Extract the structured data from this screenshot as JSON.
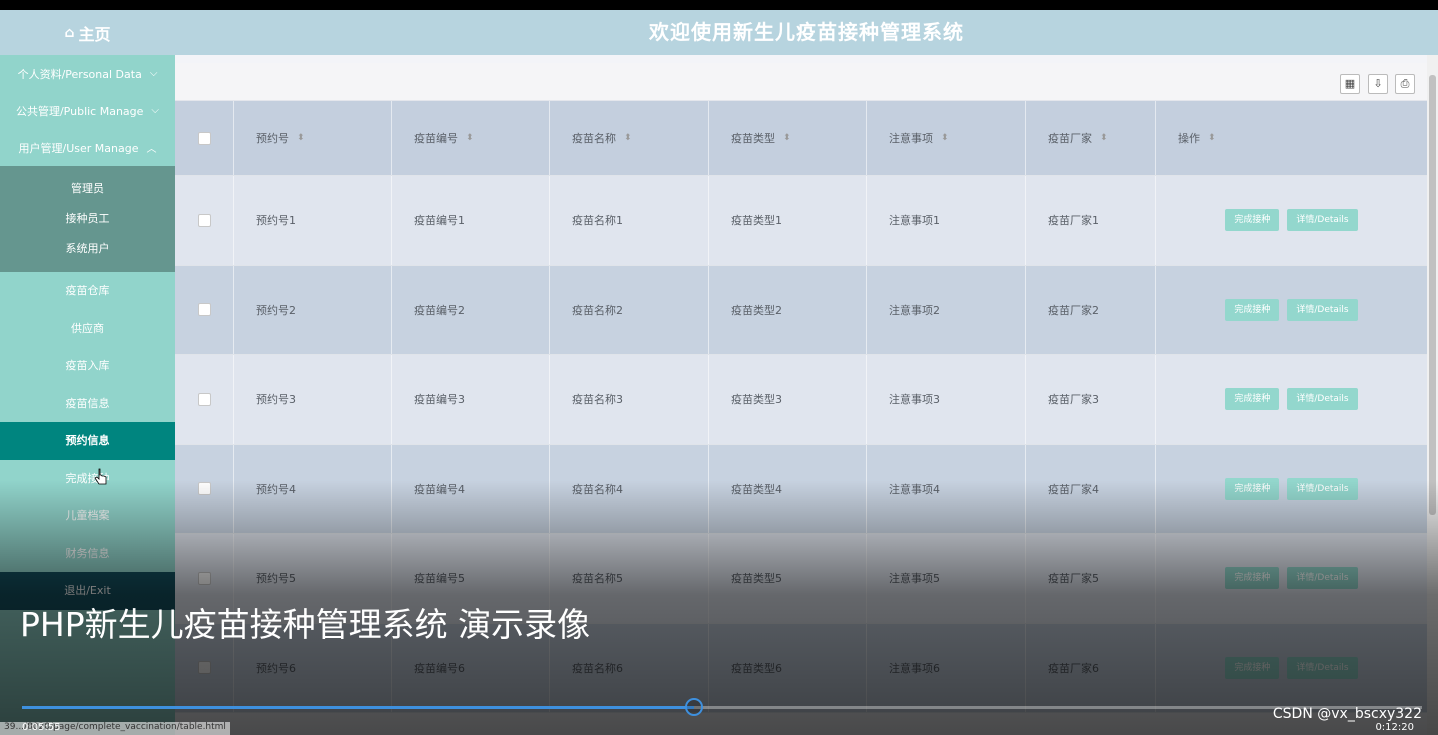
{
  "header": {
    "home_label": "主页",
    "title": "欢迎使用新生儿疫苗接种管理系统"
  },
  "sidebar": {
    "groups": [
      {
        "label": "个人资料/Personal Data"
      },
      {
        "label": "公共管理/Public Manage"
      },
      {
        "label": "用户管理/User Manage"
      }
    ],
    "submenu": [
      "管理员",
      "接种员工",
      "系统用户"
    ],
    "items": [
      "疫苗仓库",
      "供应商",
      "疫苗入库",
      "疫苗信息",
      "预约信息",
      "完成接种",
      "儿童档案",
      "财务信息",
      "退出/Exit"
    ],
    "active_index": 4
  },
  "table": {
    "headers": [
      "预约号",
      "疫苗编号",
      "疫苗名称",
      "疫苗类型",
      "注意事项",
      "疫苗厂家",
      "操作"
    ],
    "rows": [
      [
        "预约号1",
        "疫苗编号1",
        "疫苗名称1",
        "疫苗类型1",
        "注意事项1",
        "疫苗厂家1"
      ],
      [
        "预约号2",
        "疫苗编号2",
        "疫苗名称2",
        "疫苗类型2",
        "注意事项2",
        "疫苗厂家2"
      ],
      [
        "预约号3",
        "疫苗编号3",
        "疫苗名称3",
        "疫苗类型3",
        "注意事项3",
        "疫苗厂家3"
      ],
      [
        "预约号4",
        "疫苗编号4",
        "疫苗名称4",
        "疫苗类型4",
        "注意事项4",
        "疫苗厂家4"
      ],
      [
        "预约号5",
        "疫苗编号5",
        "疫苗名称5",
        "疫苗类型5",
        "注意事项5",
        "疫苗厂家5"
      ],
      [
        "预约号6",
        "疫苗编号6",
        "疫苗名称6",
        "疫苗类型6",
        "注意事项6",
        "疫苗厂家6"
      ]
    ],
    "action_complete": "完成接种",
    "action_details": "详情/Details"
  },
  "video": {
    "caption": "PHP新生儿疫苗接种管理系统 演示录像",
    "time_current": "0:05:55",
    "time_total": "0:12:20",
    "progress": 0.48,
    "watermark": "CSDN @vx_bscxy322",
    "status_url": "39.../8020/page/complete_vaccination/table.html"
  },
  "colors": {
    "header": "#b7d4df",
    "sidebar": "#91d4cb",
    "active": "#00857f",
    "button": "#93d7cd",
    "progress": "#3e90de"
  }
}
